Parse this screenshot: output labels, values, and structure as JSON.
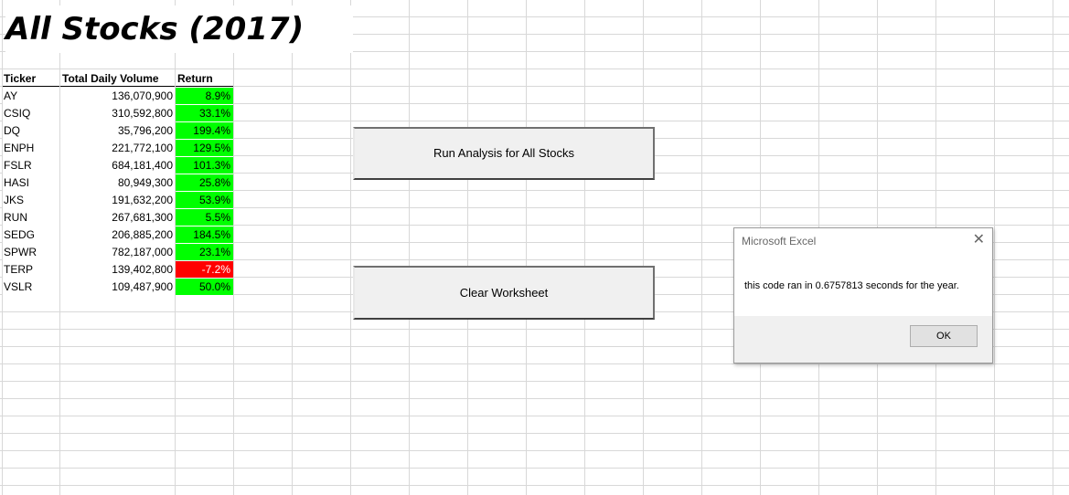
{
  "sheet": {
    "title": "All Stocks (2017)",
    "headers": {
      "ticker": "Ticker",
      "volume": "Total Daily Volume",
      "return": "Return"
    },
    "rows": [
      {
        "ticker": "AY",
        "volume": "136,070,900",
        "return": "8.9%",
        "positive": true
      },
      {
        "ticker": "CSIQ",
        "volume": "310,592,800",
        "return": "33.1%",
        "positive": true
      },
      {
        "ticker": "DQ",
        "volume": "35,796,200",
        "return": "199.4%",
        "positive": true
      },
      {
        "ticker": "ENPH",
        "volume": "221,772,100",
        "return": "129.5%",
        "positive": true
      },
      {
        "ticker": "FSLR",
        "volume": "684,181,400",
        "return": "101.3%",
        "positive": true
      },
      {
        "ticker": "HASI",
        "volume": "80,949,300",
        "return": "25.8%",
        "positive": true
      },
      {
        "ticker": "JKS",
        "volume": "191,632,200",
        "return": "53.9%",
        "positive": true
      },
      {
        "ticker": "RUN",
        "volume": "267,681,300",
        "return": "5.5%",
        "positive": true
      },
      {
        "ticker": "SEDG",
        "volume": "206,885,200",
        "return": "184.5%",
        "positive": true
      },
      {
        "ticker": "SPWR",
        "volume": "782,187,000",
        "return": "23.1%",
        "positive": true
      },
      {
        "ticker": "TERP",
        "volume": "139,402,800",
        "return": "-7.2%",
        "positive": false
      },
      {
        "ticker": "VSLR",
        "volume": "109,487,900",
        "return": "50.0%",
        "positive": true
      }
    ]
  },
  "buttons": {
    "run_label": "Run Analysis for All Stocks",
    "clear_label": "Clear Worksheet"
  },
  "dialog": {
    "title": "Microsoft Excel",
    "message": "this code ran in 0.6757813 seconds for the year.",
    "ok_label": "OK",
    "close_icon": "close-icon"
  },
  "colors": {
    "positive_fill": "#00ff00",
    "negative_fill": "#ff0000"
  }
}
